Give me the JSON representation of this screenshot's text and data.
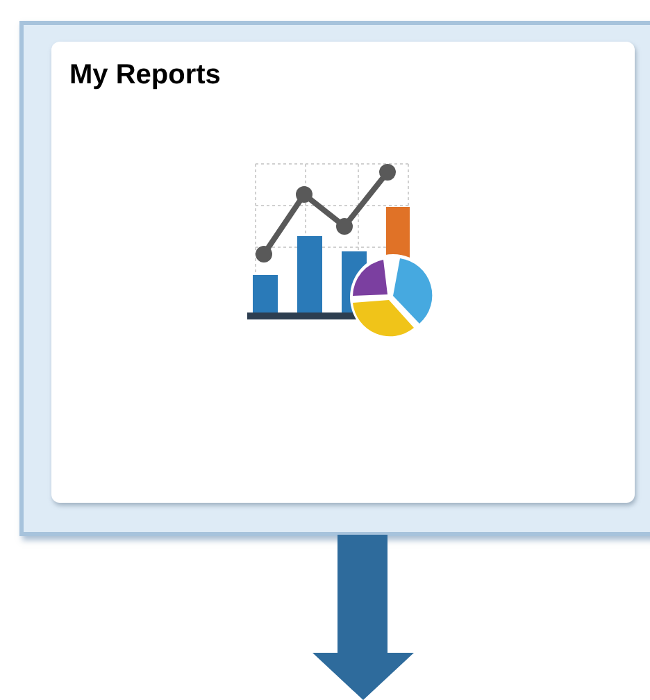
{
  "tile": {
    "title": "My Reports"
  }
}
